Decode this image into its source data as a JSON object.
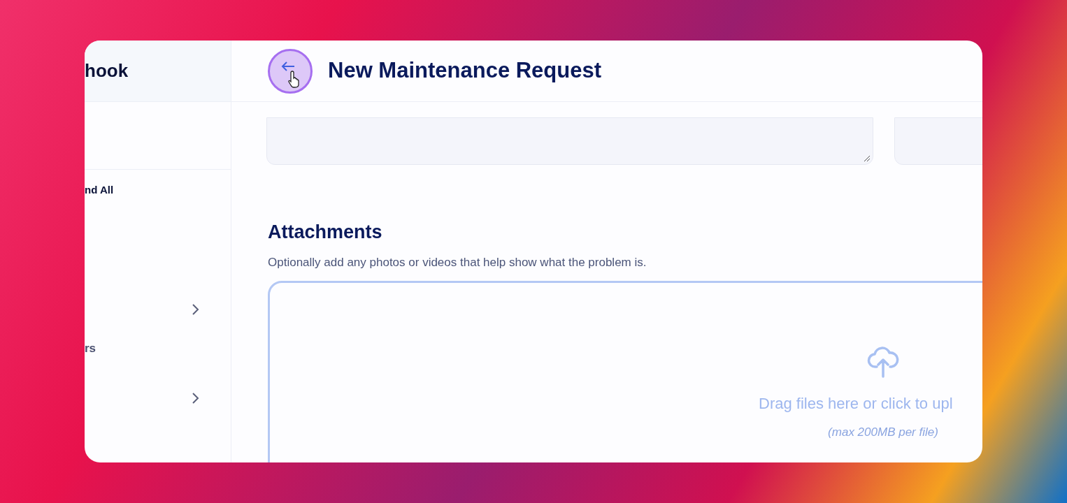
{
  "sidebar": {
    "brand": "hook",
    "items": [
      {
        "label": "nd All"
      },
      {
        "label": "rs"
      }
    ]
  },
  "header": {
    "title": "New Maintenance Request"
  },
  "attachments": {
    "heading": "Attachments",
    "description": "Optionally add any photos or videos that help show what the problem is.",
    "dropzone_text": "Drag files here or click to upl",
    "dropzone_hint": "(max 200MB per file)"
  }
}
